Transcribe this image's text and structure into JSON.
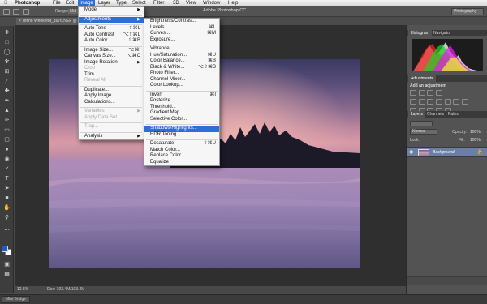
{
  "menubar": {
    "apple": "",
    "app_name": "Photoshop",
    "items": [
      "File",
      "Edit",
      "Image",
      "Layer",
      "Type",
      "Select",
      "Filter",
      "3D",
      "View",
      "Window",
      "Help"
    ],
    "active_item": "Image",
    "window_title": "Adobe Photoshop CC"
  },
  "options_bar": {
    "range_label": "Range:",
    "range_value": "Mid",
    "workspace": "Photography"
  },
  "document": {
    "tab_title": "× Tofino Weekend_1676.NEF @ 12..."
  },
  "status": {
    "zoom": "12.5%",
    "doc_size": "Doc: 103.4M/103.4M"
  },
  "bottom": {
    "mini_bridge": "Mini Bridge"
  },
  "panels": {
    "histogram_tab": "Histogram",
    "navigator_tab": "Navigator",
    "adjustments_tab": "Adjustments",
    "add_adjustment": "Add an adjustment",
    "layers_tab": "Layers",
    "channels_tab": "Channels",
    "paths_tab": "Paths",
    "blend_mode": "Normal",
    "opacity_label": "Opacity:",
    "opacity_value": "100%",
    "lock_label": "Lock:",
    "fill_label": "Fill:",
    "fill_value": "100%",
    "layer_name": "Background"
  },
  "image_menu": {
    "items": [
      {
        "label": "Mode",
        "shortcut": "",
        "submenu": true,
        "disabled": false
      },
      {
        "sep": true
      },
      {
        "label": "Adjustments",
        "shortcut": "",
        "submenu": true,
        "disabled": false,
        "highlight": true
      },
      {
        "sep": true
      },
      {
        "label": "Auto Tone",
        "shortcut": "⇧⌘L",
        "disabled": false
      },
      {
        "label": "Auto Contrast",
        "shortcut": "⌥⇧⌘L",
        "disabled": false
      },
      {
        "label": "Auto Color",
        "shortcut": "⇧⌘B",
        "disabled": false
      },
      {
        "sep": true
      },
      {
        "label": "Image Size...",
        "shortcut": "⌥⌘I",
        "disabled": false
      },
      {
        "label": "Canvas Size...",
        "shortcut": "⌥⌘C",
        "disabled": false
      },
      {
        "label": "Image Rotation",
        "shortcut": "",
        "submenu": true,
        "disabled": false
      },
      {
        "label": "Crop",
        "shortcut": "",
        "disabled": true
      },
      {
        "label": "Trim...",
        "shortcut": "",
        "disabled": false
      },
      {
        "label": "Reveal All",
        "shortcut": "",
        "disabled": true
      },
      {
        "sep": true
      },
      {
        "label": "Duplicate...",
        "shortcut": "",
        "disabled": false
      },
      {
        "label": "Apply Image...",
        "shortcut": "",
        "disabled": false
      },
      {
        "label": "Calculations...",
        "shortcut": "",
        "disabled": false
      },
      {
        "sep": true
      },
      {
        "label": "Variables",
        "shortcut": "",
        "submenu": true,
        "disabled": true
      },
      {
        "label": "Apply Data Set...",
        "shortcut": "",
        "disabled": true
      },
      {
        "sep": true
      },
      {
        "label": "Trap...",
        "shortcut": "",
        "disabled": true
      },
      {
        "sep": true
      },
      {
        "label": "Analysis",
        "shortcut": "",
        "submenu": true,
        "disabled": false
      }
    ]
  },
  "adjustments_menu": {
    "items": [
      {
        "label": "Brightness/Contrast...",
        "shortcut": ""
      },
      {
        "label": "Levels...",
        "shortcut": "⌘L"
      },
      {
        "label": "Curves...",
        "shortcut": "⌘M"
      },
      {
        "label": "Exposure...",
        "shortcut": ""
      },
      {
        "sep": true
      },
      {
        "label": "Vibrance...",
        "shortcut": ""
      },
      {
        "label": "Hue/Saturation...",
        "shortcut": "⌘U"
      },
      {
        "label": "Color Balance...",
        "shortcut": "⌘B"
      },
      {
        "label": "Black & White...",
        "shortcut": "⌥⇧⌘B"
      },
      {
        "label": "Photo Filter...",
        "shortcut": ""
      },
      {
        "label": "Channel Mixer...",
        "shortcut": ""
      },
      {
        "label": "Color Lookup...",
        "shortcut": ""
      },
      {
        "sep": true
      },
      {
        "label": "Invert",
        "shortcut": "⌘I"
      },
      {
        "label": "Posterize...",
        "shortcut": ""
      },
      {
        "label": "Threshold...",
        "shortcut": ""
      },
      {
        "label": "Gradient Map...",
        "shortcut": ""
      },
      {
        "label": "Selective Color...",
        "shortcut": ""
      },
      {
        "sep": true
      },
      {
        "label": "Shadows/Highlights...",
        "shortcut": "",
        "highlight": true
      },
      {
        "label": "HDR Toning...",
        "shortcut": ""
      },
      {
        "sep": true
      },
      {
        "label": "Desaturate",
        "shortcut": "⇧⌘U"
      },
      {
        "label": "Match Color...",
        "shortcut": ""
      },
      {
        "label": "Replace Color...",
        "shortcut": ""
      },
      {
        "label": "Equalize",
        "shortcut": ""
      }
    ]
  },
  "colors": {
    "highlight": "#2f6ed8",
    "foreground_swatch": "#1e5bd0",
    "background_swatch": "#ffffff"
  }
}
